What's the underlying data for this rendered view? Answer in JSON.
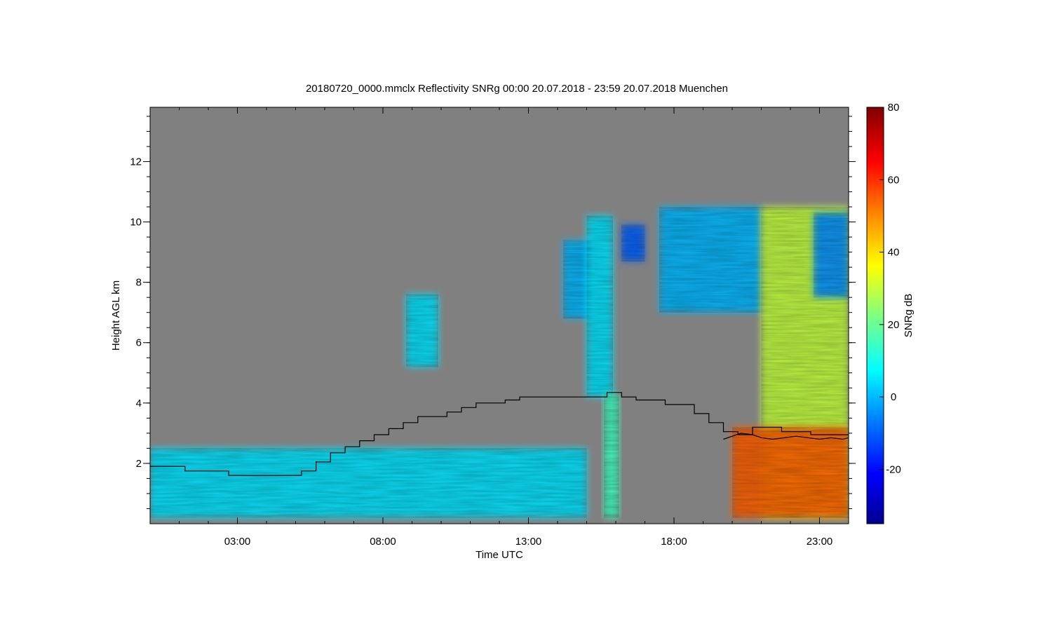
{
  "title": "20180720_0000.mmclx Reflectivity SNRg   00:00 20.07.2018 - 23:59 20.07.2018 Muenchen",
  "chart_data": {
    "type": "heatmap",
    "title": "20180720_0000.mmclx Reflectivity SNRg   00:00 20.07.2018 - 23:59 20.07.2018 Muenchen",
    "xlabel": "Time UTC",
    "ylabel": "Height AGL km",
    "xlim": [
      0,
      24
    ],
    "ylim": [
      0,
      13.8
    ],
    "x_ticks": [
      {
        "value": 3,
        "label": "03:00"
      },
      {
        "value": 8,
        "label": "08:00"
      },
      {
        "value": 13,
        "label": "13:00"
      },
      {
        "value": 18,
        "label": "18:00"
      },
      {
        "value": 23,
        "label": "23:00"
      }
    ],
    "y_ticks": [
      {
        "value": 2,
        "label": "2"
      },
      {
        "value": 4,
        "label": "4"
      },
      {
        "value": 6,
        "label": "6"
      },
      {
        "value": 8,
        "label": "8"
      },
      {
        "value": 10,
        "label": "10"
      },
      {
        "value": 12,
        "label": "12"
      }
    ],
    "background_color": "#808080",
    "colorbar": {
      "label": "SNRg dB",
      "min": -35,
      "max": 80,
      "ticks": [
        {
          "value": -20,
          "label": "-20"
        },
        {
          "value": 0,
          "label": "0"
        },
        {
          "value": 20,
          "label": "20"
        },
        {
          "value": 40,
          "label": "40"
        },
        {
          "value": 60,
          "label": "60"
        },
        {
          "value": 80,
          "label": "80"
        }
      ],
      "colors": [
        "#00008f",
        "#0000ff",
        "#0080ff",
        "#00ffff",
        "#80ff80",
        "#ffff00",
        "#ff8000",
        "#ff0000",
        "#800000"
      ]
    },
    "cloud_regions": [
      {
        "x": [
          8.8,
          9.9
        ],
        "y": [
          5.2,
          7.6
        ],
        "snr": 5
      },
      {
        "x": [
          14.2,
          15.2
        ],
        "y": [
          6.8,
          9.4
        ],
        "snr": 0
      },
      {
        "x": [
          15.0,
          15.9
        ],
        "y": [
          4.2,
          10.2
        ],
        "snr": 5
      },
      {
        "x": [
          15.6,
          16.1
        ],
        "y": [
          0.2,
          4.3
        ],
        "snr": 15
      },
      {
        "x": [
          16.2,
          17.0
        ],
        "y": [
          8.7,
          9.9
        ],
        "snr": -10
      },
      {
        "x": [
          17.5,
          21.0
        ],
        "y": [
          7.0,
          10.5
        ],
        "snr": 0
      },
      {
        "x": [
          21.0,
          24.0
        ],
        "y": [
          0.2,
          10.5
        ],
        "snr": 30
      },
      {
        "x": [
          22.8,
          24.0
        ],
        "y": [
          7.5,
          10.3
        ],
        "snr": -5
      },
      {
        "x": [
          20.0,
          24.0
        ],
        "y": [
          0.2,
          3.2
        ],
        "snr": 55
      },
      {
        "x": [
          0.0,
          15.0
        ],
        "y": [
          0.2,
          2.5
        ],
        "snr": 5
      }
    ],
    "series": [
      {
        "type": "line",
        "x": [
          0.0,
          1.2,
          1.2,
          2.7,
          2.7,
          5.2,
          5.2,
          5.7,
          5.7,
          6.2,
          6.2,
          6.7,
          6.7,
          7.2,
          7.2,
          7.7,
          7.7,
          8.2,
          8.2,
          8.7,
          8.7,
          9.2,
          9.2,
          10.2,
          10.2,
          10.7,
          10.7,
          11.2,
          11.2,
          12.2,
          12.2,
          12.7,
          12.7,
          15.7,
          15.7,
          16.2,
          16.2,
          16.7,
          16.7,
          17.7,
          17.7,
          18.7,
          18.7,
          19.2,
          19.2,
          19.7,
          19.7,
          20.2,
          20.2,
          20.7,
          20.7,
          21.7,
          21.7,
          22.7,
          22.7,
          23.7,
          23.7,
          24.0
        ],
        "y": [
          1.9,
          1.9,
          1.75,
          1.75,
          1.6,
          1.6,
          1.75,
          1.75,
          2.05,
          2.05,
          2.35,
          2.35,
          2.55,
          2.55,
          2.75,
          2.75,
          2.95,
          2.95,
          3.15,
          3.15,
          3.35,
          3.35,
          3.55,
          3.55,
          3.7,
          3.7,
          3.85,
          3.85,
          4.0,
          4.0,
          4.1,
          4.1,
          4.2,
          4.2,
          4.35,
          4.35,
          4.2,
          4.2,
          4.1,
          4.1,
          3.95,
          3.95,
          3.65,
          3.65,
          3.35,
          3.35,
          3.05,
          3.05,
          2.95,
          2.95,
          3.2,
          3.2,
          3.05,
          3.05,
          2.95,
          2.95,
          2.95,
          2.95
        ]
      },
      {
        "type": "line",
        "x": [
          19.7,
          20.0,
          20.3,
          20.7,
          21.0,
          21.4,
          21.8,
          22.2,
          22.6,
          23.0,
          23.4,
          23.8,
          24.0
        ],
        "y": [
          2.8,
          2.9,
          3.0,
          2.95,
          2.85,
          2.8,
          2.85,
          2.9,
          2.85,
          2.8,
          2.85,
          2.8,
          2.85
        ]
      }
    ]
  }
}
